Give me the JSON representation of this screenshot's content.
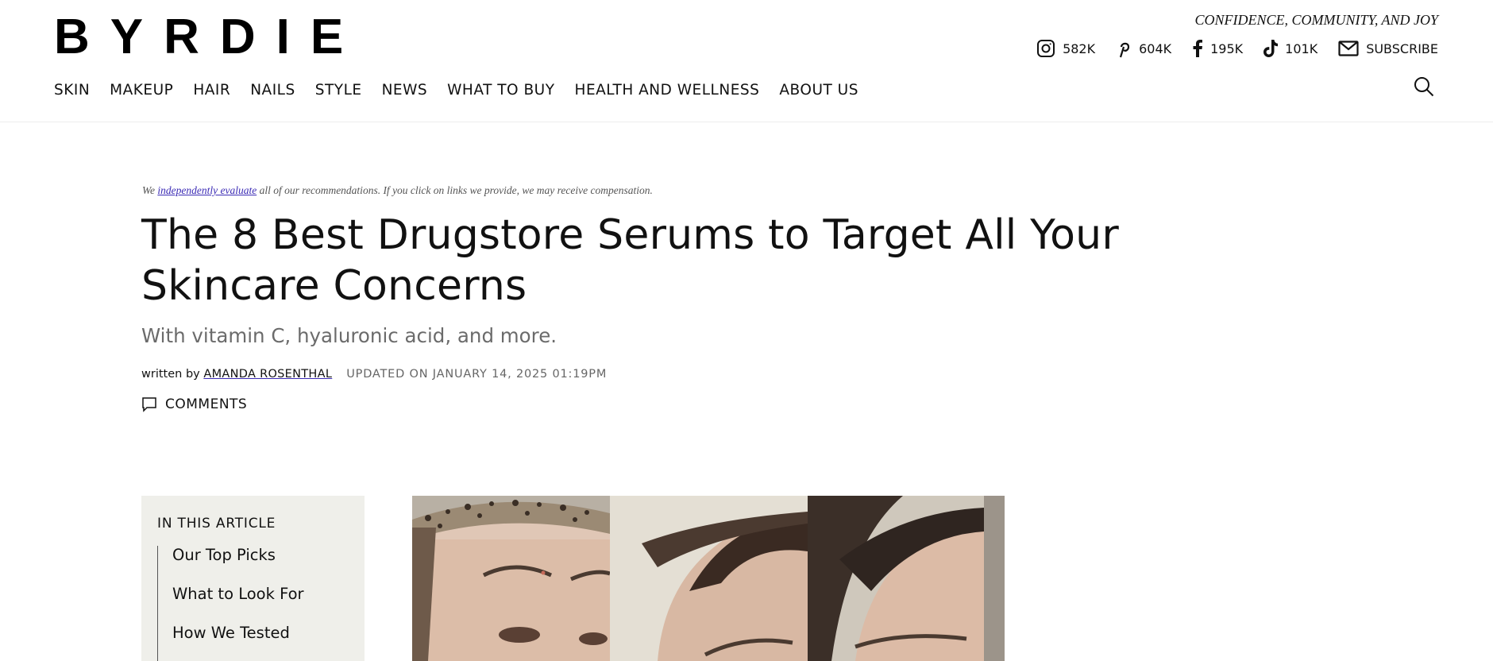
{
  "header": {
    "logo": "BYRDIE",
    "tagline": "CONFIDENCE, COMMUNITY, AND JOY",
    "social": [
      {
        "icon": "instagram-icon",
        "count": "582K"
      },
      {
        "icon": "pinterest-icon",
        "count": "604K"
      },
      {
        "icon": "facebook-icon",
        "count": "195K"
      },
      {
        "icon": "tiktok-icon",
        "count": "101K"
      }
    ],
    "subscribe_label": "SUBSCRIBE",
    "search_icon": "search-icon",
    "nav": [
      "SKIN",
      "MAKEUP",
      "HAIR",
      "NAILS",
      "STYLE",
      "NEWS",
      "WHAT TO BUY",
      "HEALTH AND WELLNESS",
      "ABOUT US"
    ]
  },
  "article": {
    "disclaimer_pre": "We ",
    "disclaimer_link": "independently evaluate",
    "disclaimer_post": " all of our recommendations. If you click on links we provide, we may receive compensation.",
    "title": "The 8 Best Drugstore Serums to Target All Your Skincare Concerns",
    "subtitle": "With vitamin C, hyaluronic acid, and more.",
    "written_by": "written by",
    "author": "AMANDA ROSENTHAL",
    "updated": "UPDATED ON JANUARY 14, 2025 01:19PM",
    "comments_label": "COMMENTS"
  },
  "toc": {
    "heading": "IN THIS ARTICLE",
    "items": [
      "Our Top Picks",
      "What to Look For",
      "How We Tested"
    ]
  },
  "colors": {
    "link": "#3b2bb5",
    "toc_bg": "#efefea"
  }
}
